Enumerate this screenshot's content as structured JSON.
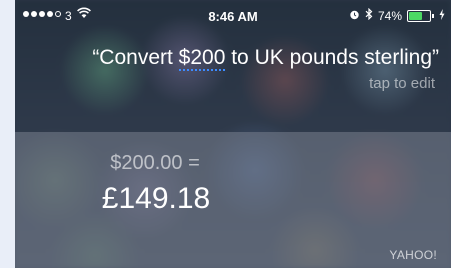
{
  "status_bar": {
    "carrier": "3",
    "time": "8:46 AM",
    "battery_percent": "74%",
    "battery_level": 0.74,
    "signal_bars_filled": 4,
    "signal_bars_total": 5,
    "icons": [
      "wifi-icon",
      "alarm-icon",
      "bluetooth-icon",
      "battery-icon",
      "charging-icon"
    ]
  },
  "query": {
    "text_prefix": "“Convert ",
    "text_amount": "$200",
    "text_suffix": " to UK pounds sterling”",
    "edit_hint": "tap to edit"
  },
  "result": {
    "from": "$200.00 =",
    "to": "£149.18",
    "source": "YAHOO!"
  },
  "colors": {
    "accent_underline": "#3d8bff",
    "battery": "#4cd964"
  }
}
